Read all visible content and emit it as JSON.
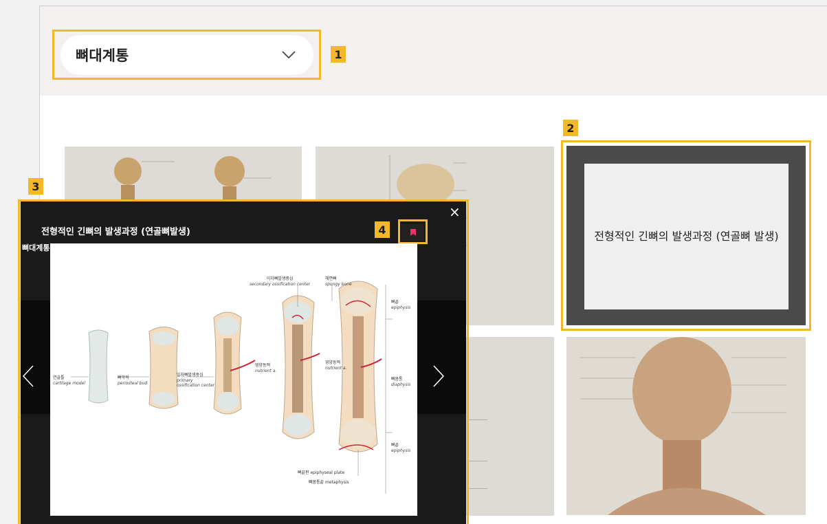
{
  "dropdown": {
    "selected": "뼈대계통"
  },
  "callouts": [
    "1",
    "2",
    "3",
    "4"
  ],
  "hover_card": {
    "title": "전형적인 긴뼈의 발생과정 (연골뼈 발생)"
  },
  "modal": {
    "title": "전형적인 긴뼈의 발생과정 (연골뼈발생)",
    "close": "×",
    "prev": "‹",
    "next": "›",
    "side_text": "뼈대계통"
  },
  "figure": {
    "labels": {
      "cartilage_ko": "연골틀",
      "cartilage_en": "cartilage model",
      "bud_ko": "뼈막싹",
      "bud_en": "periosteal bud",
      "primary_ko": "일차뼈발생중심",
      "primary_en1": "primary",
      "primary_en2": "ossification center",
      "nutrient1_ko": "영양동맥",
      "nutrient1_en": "nutrient a.",
      "secondary_ko": "이차뼈발생중심",
      "secondary_en": "secondary ossification center",
      "spongy_ko": "해면뼈",
      "spongy_en": "spongy bone",
      "nutrient2_ko": "영양동맥",
      "nutrient2_en": "nutrient a.",
      "epi_top_ko": "뼈끝",
      "epi_top_en": "epiphysis",
      "diaphysis_ko": "뼈몸통",
      "diaphysis_en": "diaphysis",
      "epi_bot_ko": "뼈끝",
      "epi_bot_en": "epiphysis",
      "plate": "뼈끝판 epiphyseal plate",
      "metaphysis": "뼈몸통끝 metaphysis"
    }
  },
  "colors": {
    "accent": "#f2b829",
    "bookmark": "#e8326a",
    "bone": "#f3dcc0",
    "cartilage": "#dfe6e4",
    "artery": "#c8283a"
  }
}
